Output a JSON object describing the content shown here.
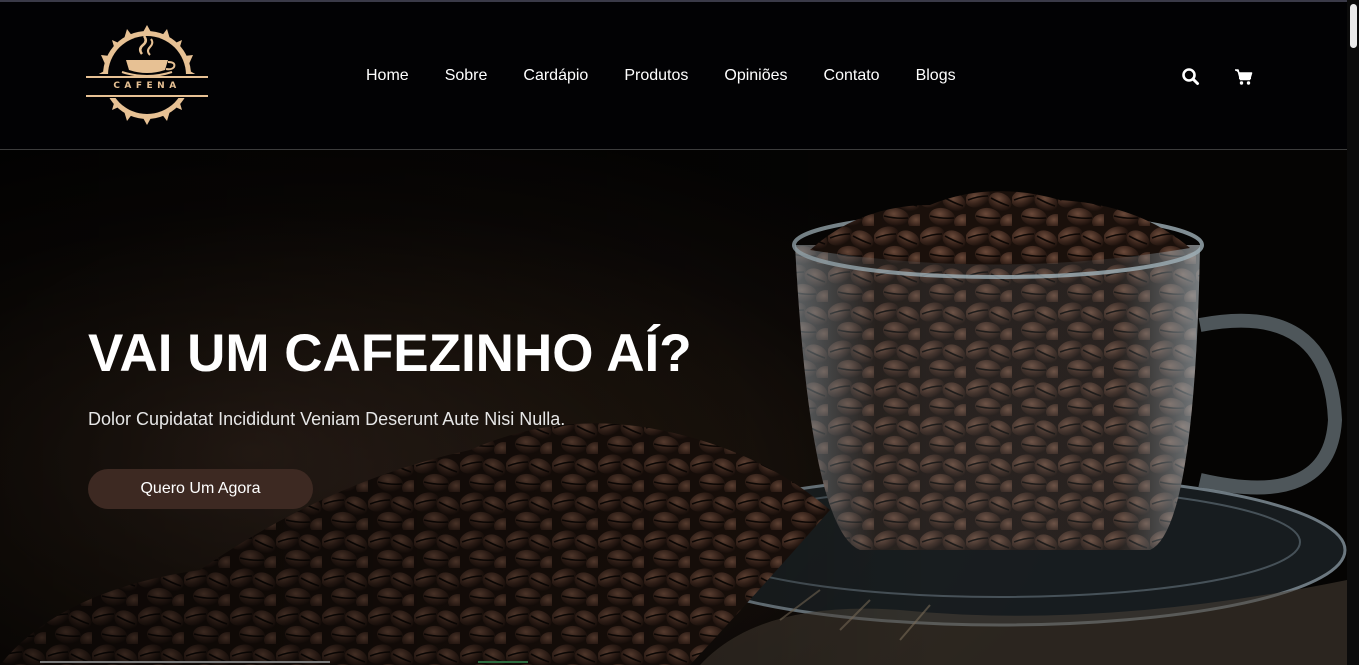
{
  "brand": {
    "name": "CAFENA",
    "logo_icon": "coffee-cup-icon",
    "colors": {
      "logo": "#e7c194",
      "accent": "#3d2922"
    }
  },
  "nav": {
    "items": [
      {
        "label": "Home"
      },
      {
        "label": "Sobre"
      },
      {
        "label": "Cardápio"
      },
      {
        "label": "Produtos"
      },
      {
        "label": "Opiniões"
      },
      {
        "label": "Contato"
      },
      {
        "label": "Blogs"
      }
    ],
    "actions": [
      {
        "icon": "search-icon"
      },
      {
        "icon": "shopping-cart-icon"
      }
    ]
  },
  "hero": {
    "title": "VAI UM CAFEZINHO AÍ?",
    "subtitle": "Dolor Cupidatat Incididunt Veniam Deserunt Aute Nisi Nulla.",
    "cta_label": "Quero Um Agora",
    "image": "coffee-beans-glass-cup"
  }
}
